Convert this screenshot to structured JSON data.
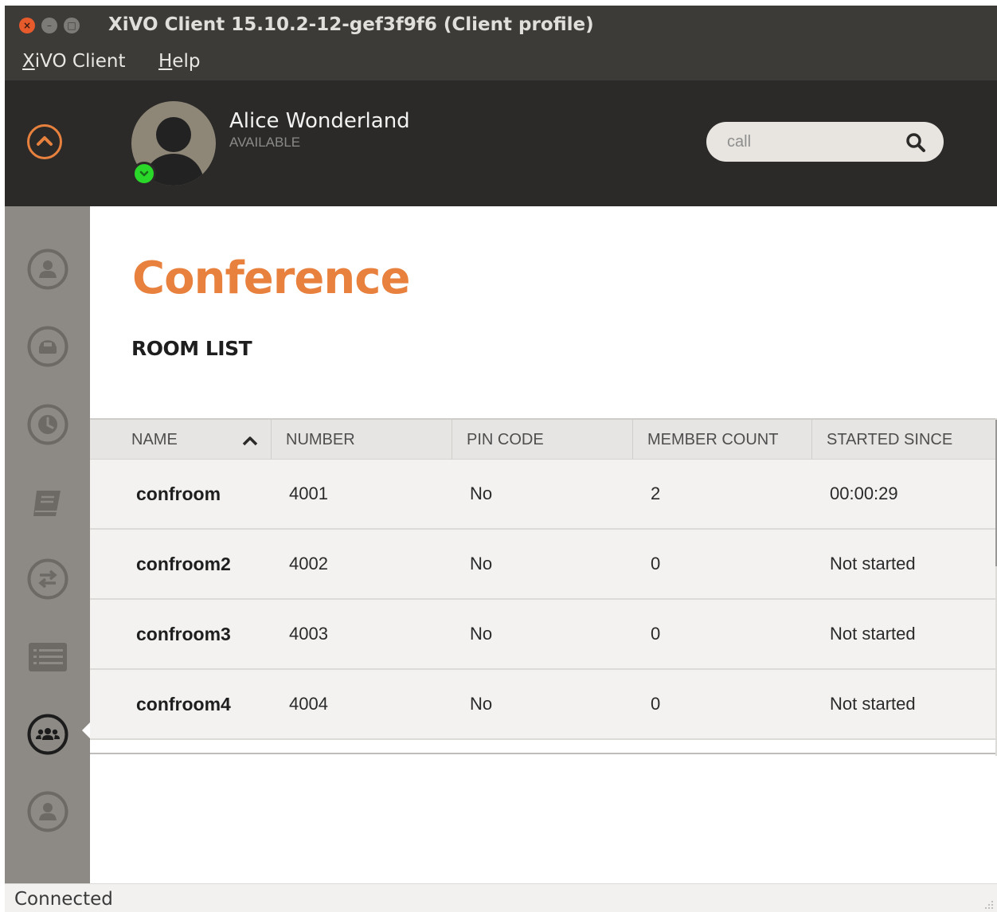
{
  "window": {
    "title": "XiVO Client 15.10.2-12-gef3f9f6 (Client profile)",
    "close_glyph": "×",
    "min_glyph": "–",
    "max_glyph": "□"
  },
  "menubar": {
    "items": [
      {
        "prefix": "",
        "accel": "X",
        "rest": "iVO Client"
      },
      {
        "prefix": "",
        "accel": "H",
        "rest": "elp"
      }
    ]
  },
  "header": {
    "user_name": "Alice Wonderland",
    "user_status": "AVAILABLE",
    "search_placeholder": "call"
  },
  "sidebar": {
    "items": [
      {
        "icon": "person-icon",
        "active": false
      },
      {
        "icon": "phone-icon",
        "active": false
      },
      {
        "icon": "clock-icon",
        "active": false
      },
      {
        "icon": "book-icon",
        "active": false
      },
      {
        "icon": "transfer-icon",
        "active": false
      },
      {
        "icon": "list-icon",
        "active": false
      },
      {
        "icon": "group-icon",
        "active": true
      },
      {
        "icon": "person-icon",
        "active": false
      }
    ]
  },
  "page": {
    "title": "Conference",
    "section": "ROOM LIST"
  },
  "table": {
    "columns": [
      "NAME",
      "NUMBER",
      "PIN CODE",
      "MEMBER COUNT",
      "STARTED SINCE"
    ],
    "sort_column": "NAME",
    "sort_direction": "ascending",
    "rows": [
      {
        "name": "confroom",
        "number": "4001",
        "pin": "No",
        "members": "2",
        "started": "00:00:29"
      },
      {
        "name": "confroom2",
        "number": "4002",
        "pin": "No",
        "members": "0",
        "started": "Not started"
      },
      {
        "name": "confroom3",
        "number": "4003",
        "pin": "No",
        "members": "0",
        "started": "Not started"
      },
      {
        "name": "confroom4",
        "number": "4004",
        "pin": "No",
        "members": "0",
        "started": "Not started"
      }
    ]
  },
  "statusbar": {
    "text": "Connected"
  },
  "colors": {
    "accent": "#e8813e",
    "titlebar": "#3c3b37",
    "header_bg": "#2b2a28",
    "sidebar_bg": "#8d8a85",
    "online": "#2ad82a"
  }
}
